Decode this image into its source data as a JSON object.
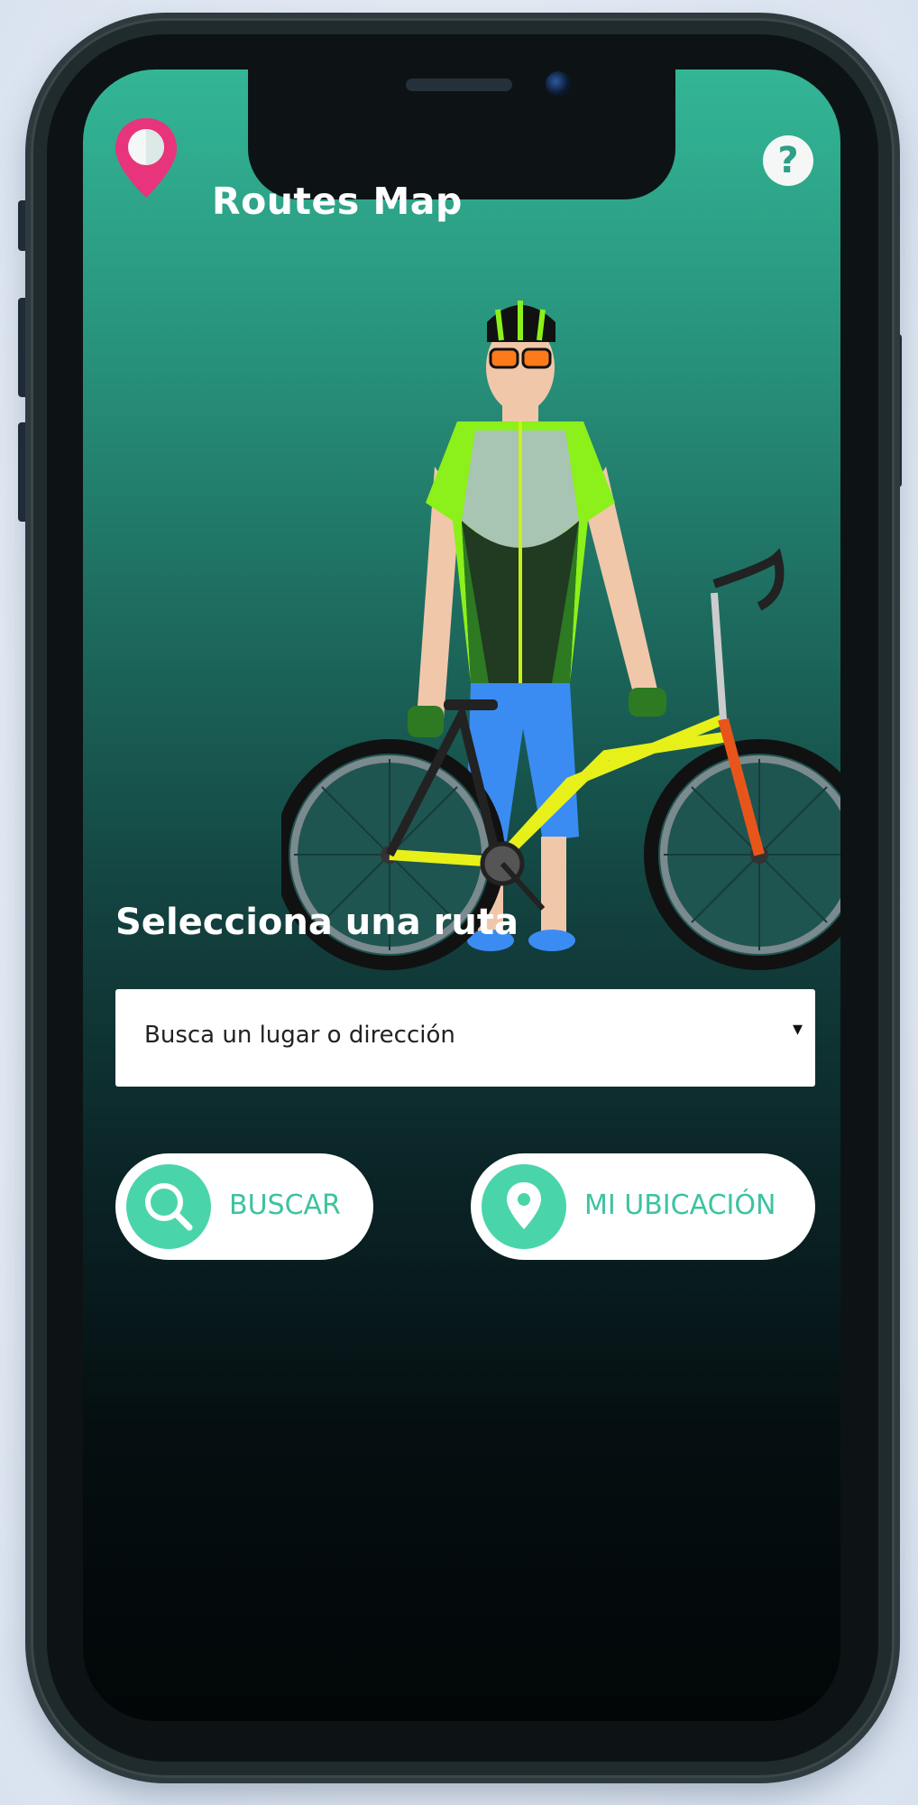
{
  "app": {
    "title": "Routes Map"
  },
  "header": {
    "help_label": "?"
  },
  "route_section": {
    "heading": "Selecciona una ruta",
    "select_placeholder": "Busca un lugar o dirección",
    "select_caret": "▾"
  },
  "actions": {
    "search_label": "BUSCAR",
    "location_label": "MI UBICACIÓN"
  },
  "icons": {
    "logo": "map-pin-icon",
    "help": "question-icon",
    "search": "magnifier-icon",
    "location": "location-pin-icon",
    "dropdown": "caret-down-icon"
  },
  "colors": {
    "accent": "#4ad4aa",
    "accent_text": "#3cc3a0",
    "logo_pink": "#e8347a",
    "gradient_top": "#33b696",
    "gradient_bottom": "#020607"
  }
}
